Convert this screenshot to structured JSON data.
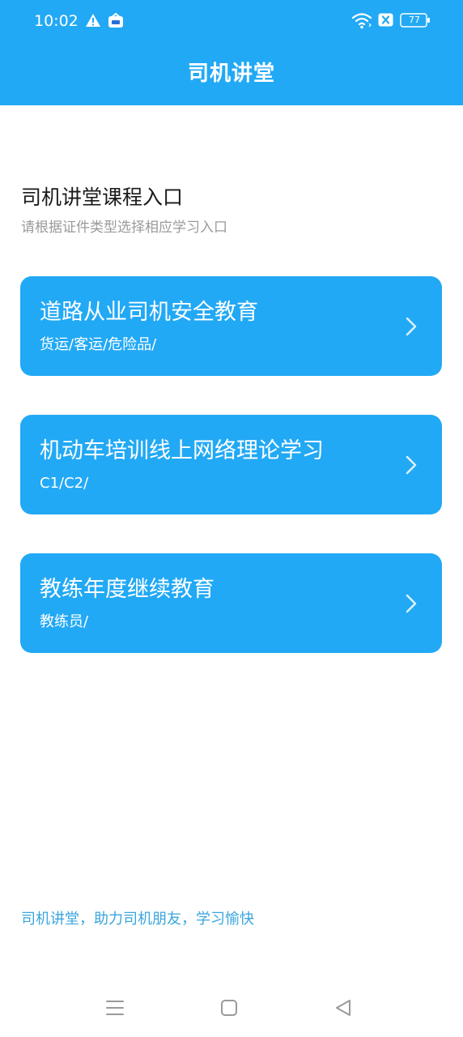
{
  "status_bar": {
    "time": "10:02",
    "battery_level": "77",
    "icons": [
      "warning-icon",
      "app-notification-icon",
      "wifi-icon",
      "no-sim-icon",
      "battery-icon"
    ]
  },
  "header": {
    "title": "司机讲堂"
  },
  "intro": {
    "title": "司机讲堂课程入口",
    "subtitle": "请根据证件类型选择相应学习入口"
  },
  "courses": [
    {
      "title": "道路从业司机安全教育",
      "subtitle": "货运/客运/危险品/"
    },
    {
      "title": "机动车培训线上网络理论学习",
      "subtitle": "C1/C2/"
    },
    {
      "title": "教练年度继续教育",
      "subtitle": "教练员/"
    }
  ],
  "footer": {
    "slogan": "司机讲堂，助力司机朋友，学习愉快"
  },
  "nav_bar": {
    "icons": [
      "menu-icon",
      "home-icon",
      "back-icon"
    ]
  },
  "colors": {
    "primary": "#22a9f5",
    "title_text": "#1a1a1a",
    "subtitle_text": "#9a9a9a",
    "footer_text": "#3aa5dc"
  }
}
